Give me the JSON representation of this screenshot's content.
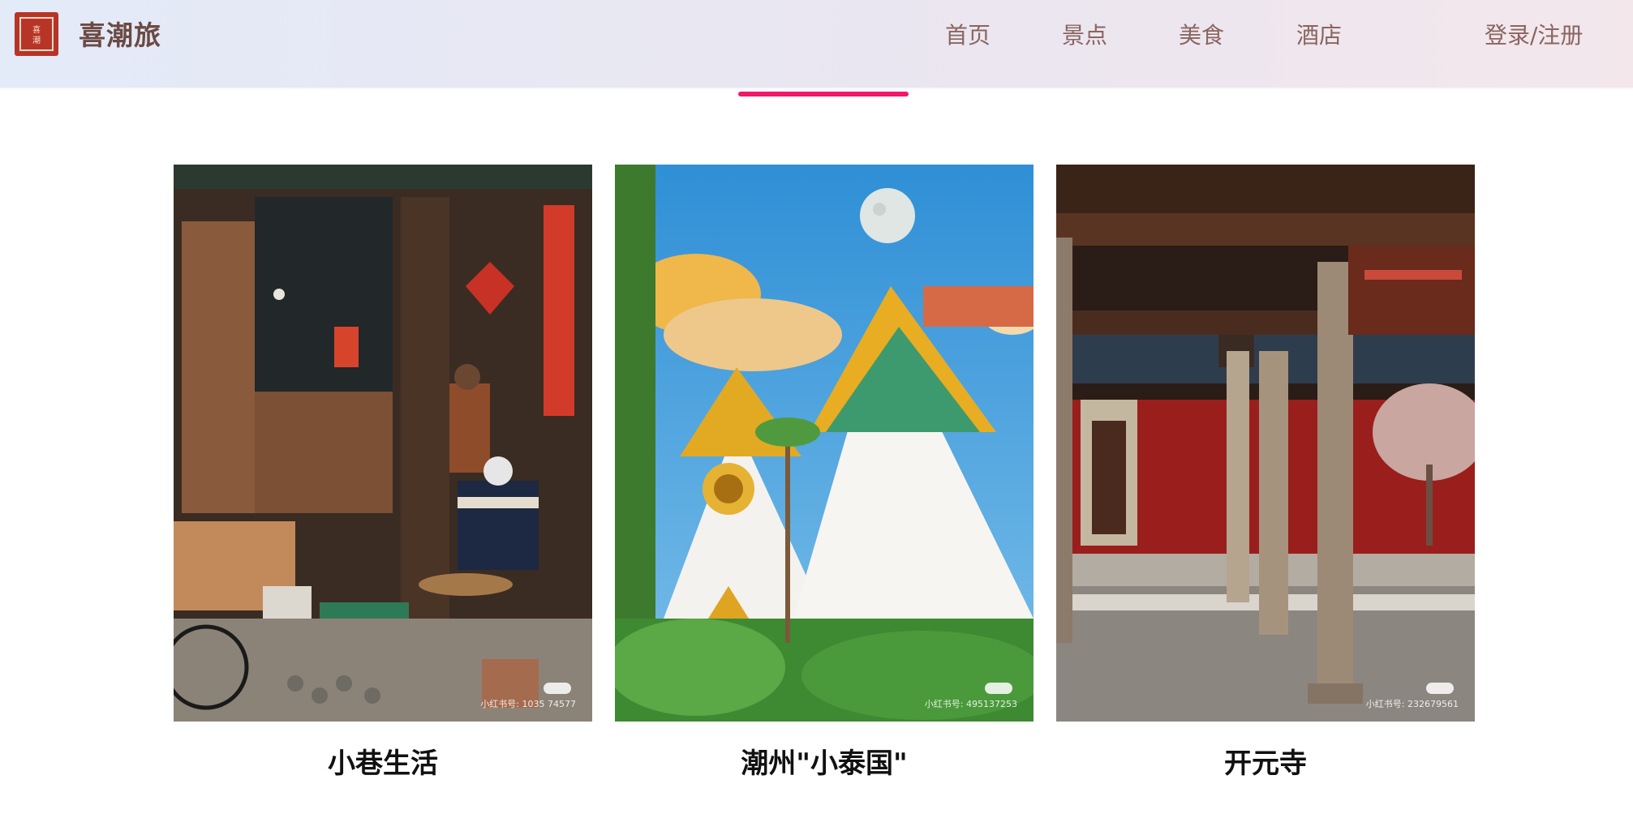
{
  "header": {
    "logo_text": "喜潮",
    "brand": "喜潮旅",
    "nav": [
      {
        "label": "首页",
        "active": false
      },
      {
        "label": "景点",
        "active": false
      },
      {
        "label": "美食",
        "active": false
      },
      {
        "label": "酒店",
        "active": false
      }
    ],
    "login_label": "登录/注册"
  },
  "cards": [
    {
      "title": "小巷生活",
      "watermark": "小红书号: 1035 74577",
      "image": "alley-craftsman-photo"
    },
    {
      "title": "潮州\"小泰国\"",
      "watermark": "小红书号: 495137253",
      "image": "thai-temple-photo"
    },
    {
      "title": "开元寺",
      "watermark": "小红书号: 232679561",
      "image": "temple-corridor-photo"
    }
  ],
  "colors": {
    "accent": "#f2186a",
    "brand_text": "#6b4a44",
    "nav_text": "#8a6560",
    "logo_bg": "#b73526"
  }
}
